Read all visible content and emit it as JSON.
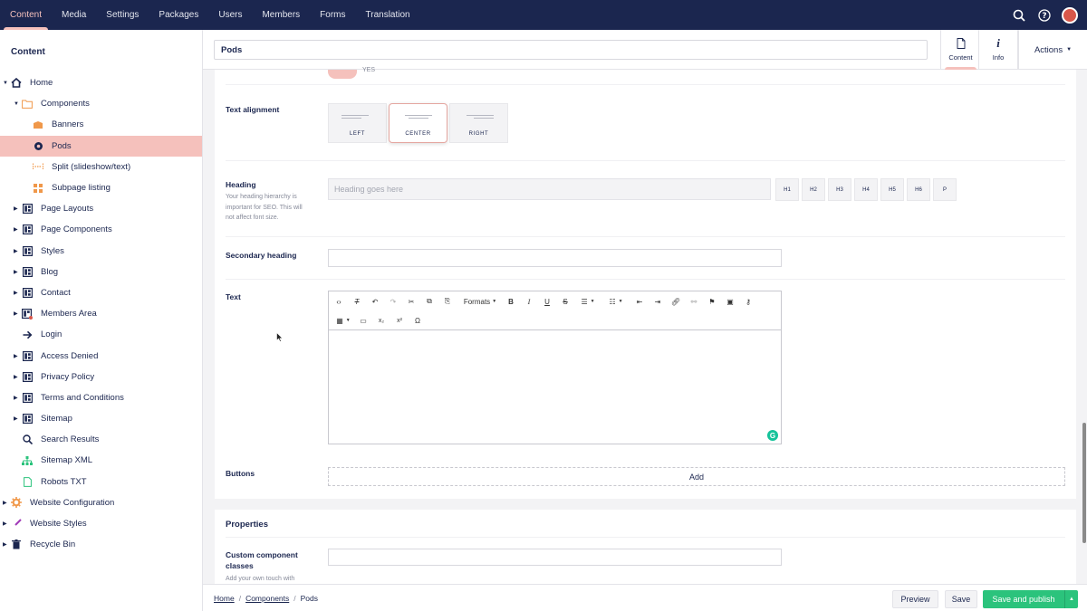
{
  "topnav": {
    "tabs": [
      "Content",
      "Media",
      "Settings",
      "Packages",
      "Users",
      "Members",
      "Forms",
      "Translation"
    ],
    "active": "Content"
  },
  "sidebar": {
    "title": "Content",
    "items": [
      {
        "label": "Home",
        "icon": "home-icon",
        "color": "#1b264f"
      },
      {
        "label": "Components",
        "icon": "folder-icon",
        "color": "#f0984a"
      },
      {
        "label": "Banners",
        "icon": "banners-icon",
        "color": "#f0984a"
      },
      {
        "label": "Pods",
        "icon": "pod-icon",
        "color": "#1b264f"
      },
      {
        "label": "Split (slideshow/text)",
        "icon": "split-icon",
        "color": "#f0984a"
      },
      {
        "label": "Subpage listing",
        "icon": "grid-icon",
        "color": "#f0984a"
      },
      {
        "label": "Page Layouts",
        "icon": "layout-icon",
        "color": "#1b264f"
      },
      {
        "label": "Page Components",
        "icon": "layout-icon",
        "color": "#1b264f"
      },
      {
        "label": "Styles",
        "icon": "layout-icon",
        "color": "#1b264f"
      },
      {
        "label": "Blog",
        "icon": "layout-icon",
        "color": "#1b264f"
      },
      {
        "label": "Contact",
        "icon": "layout-icon",
        "color": "#1b264f"
      },
      {
        "label": "Members Area",
        "icon": "layout-lock-icon",
        "color": "#1b264f"
      },
      {
        "label": "Login",
        "icon": "arrow-right-icon",
        "color": "#1b264f"
      },
      {
        "label": "Access Denied",
        "icon": "layout-icon",
        "color": "#1b264f"
      },
      {
        "label": "Privacy Policy",
        "icon": "layout-icon",
        "color": "#1b264f"
      },
      {
        "label": "Terms and Conditions",
        "icon": "layout-icon",
        "color": "#1b264f"
      },
      {
        "label": "Sitemap",
        "icon": "layout-icon",
        "color": "#1b264f"
      },
      {
        "label": "Search Results",
        "icon": "search-icon",
        "color": "#1b264f"
      },
      {
        "label": "Sitemap XML",
        "icon": "sitemap-icon",
        "color": "#2bc37c"
      },
      {
        "label": "Robots TXT",
        "icon": "document-icon",
        "color": "#2bc37c"
      },
      {
        "label": "Website Configuration",
        "icon": "gear-icon",
        "color": "#f0984a"
      },
      {
        "label": "Website Styles",
        "icon": "brush-icon",
        "color": "#a03bb8"
      },
      {
        "label": "Recycle Bin",
        "icon": "trash-icon",
        "color": "#1b264f"
      }
    ]
  },
  "header": {
    "name_value": "Pods",
    "apps": [
      "Content",
      "Info"
    ],
    "actions_label": "Actions"
  },
  "form": {
    "toggle_label": "YES",
    "text_alignment": {
      "label": "Text alignment",
      "options": [
        "LEFT",
        "CENTER",
        "RIGHT"
      ],
      "selected": "CENTER"
    },
    "heading": {
      "label": "Heading",
      "description": "Your heading hierarchy is important for SEO. This will not affect font size.",
      "placeholder": "Heading goes here",
      "levels": [
        "H1",
        "H2",
        "H3",
        "H4",
        "H5",
        "H6",
        "P"
      ]
    },
    "secondary_heading": {
      "label": "Secondary heading",
      "value": ""
    },
    "text": {
      "label": "Text",
      "formats_label": "Formats"
    },
    "buttons": {
      "label": "Buttons",
      "add_label": "Add"
    }
  },
  "properties": {
    "title": "Properties",
    "custom_classes": {
      "label": "Custom component classes",
      "description": "Add your own touch with",
      "value": ""
    }
  },
  "footer": {
    "breadcrumb": [
      "Home",
      "Components",
      "Pods"
    ],
    "preview_label": "Preview",
    "save_label": "Save",
    "publish_label": "Save and publish"
  },
  "colors": {
    "topbar": "#1b264f",
    "accent": "#f5c1bc",
    "publish": "#2bc37c"
  }
}
